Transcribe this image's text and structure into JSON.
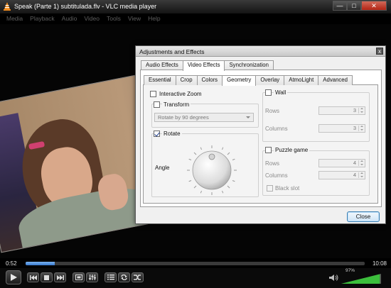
{
  "window": {
    "title": "Speak (Parte 1) subtitulada.flv - VLC media player",
    "app_icon": "vlc-cone-icon",
    "controls": {
      "minimize": "—",
      "maximize": "□",
      "close": "✕"
    }
  },
  "menu": [
    "Media",
    "Playback",
    "Audio",
    "Video",
    "Tools",
    "View",
    "Help"
  ],
  "playback": {
    "elapsed": "0:52",
    "total": "10:08",
    "progress_fraction": 0.086,
    "volume_label": "97%",
    "volume_fraction": 0.97
  },
  "dialog": {
    "title": "Adjustments and Effects",
    "close_glyph": "x",
    "tabs": [
      "Audio Effects",
      "Video Effects",
      "Synchronization"
    ],
    "active_tab": "Video Effects",
    "subtabs": [
      "Essential",
      "Crop",
      "Colors",
      "Geometry",
      "Overlay",
      "AtmoLight",
      "Advanced"
    ],
    "active_subtab": "Geometry",
    "geometry": {
      "interactive_zoom": {
        "label": "Interactive Zoom",
        "checked": false
      },
      "transform": {
        "label": "Transform",
        "checked": false,
        "select_value": "Rotate by 90 degrees"
      },
      "rotate": {
        "label": "Rotate",
        "checked": true,
        "angle_label": "Angle"
      },
      "wall": {
        "label": "Wall",
        "checked": false,
        "rows_label": "Rows",
        "rows_value": "3",
        "columns_label": "Columns",
        "columns_value": "3"
      },
      "puzzle": {
        "label": "Puzzle game",
        "checked": false,
        "rows_label": "Rows",
        "rows_value": "4",
        "columns_label": "Columns",
        "columns_value": "4",
        "black_slot_label": "Black slot",
        "black_slot_checked": false
      }
    },
    "close_button": "Close"
  }
}
